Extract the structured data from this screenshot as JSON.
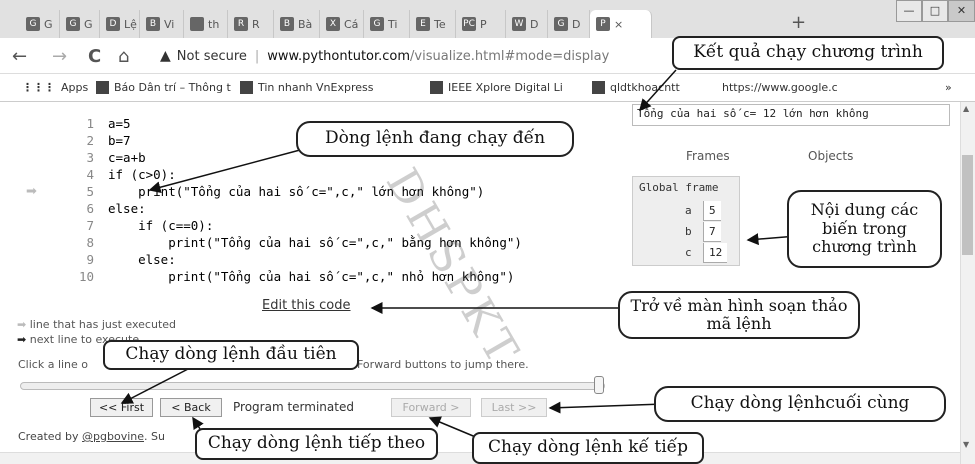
{
  "tabs": [
    {
      "label": "G",
      "fav": "G"
    },
    {
      "label": "G",
      "fav": "G"
    },
    {
      "label": "Lệ",
      "fav": "D"
    },
    {
      "label": "Vi",
      "fav": "B"
    },
    {
      "label": "th",
      "fav": ""
    },
    {
      "label": "R",
      "fav": "R"
    },
    {
      "label": "Bà",
      "fav": "B"
    },
    {
      "label": "Cá",
      "fav": "X"
    },
    {
      "label": "Ti",
      "fav": "G"
    },
    {
      "label": "Te",
      "fav": "E"
    },
    {
      "label": "P",
      "fav": "PC"
    },
    {
      "label": "D",
      "fav": "W"
    },
    {
      "label": "D",
      "fav": "G"
    },
    {
      "label": "×",
      "fav": "P"
    }
  ],
  "window_buttons": {
    "minimize": "—",
    "maximize": "□",
    "close": "✕"
  },
  "toolbar": {
    "back": "←",
    "forward": "→",
    "reload": "C",
    "home": "⌂",
    "security": "Not secure",
    "url_host": "www.pythontutor.com",
    "url_path": "/visualize.html#mode=display"
  },
  "bookmarks": [
    {
      "label": "Apps"
    },
    {
      "label": "Báo Dân trí – Thông t"
    },
    {
      "label": "Tin nhanh VnExpress"
    },
    {
      "label": "IEEE Xplore Digital Li"
    },
    {
      "label": "qldtkhoacntt"
    },
    {
      "label": "https://www.google.c"
    },
    {
      "label": "»"
    }
  ],
  "code": [
    {
      "n": "1",
      "text": "a=5"
    },
    {
      "n": "2",
      "text": "b=7"
    },
    {
      "n": "3",
      "text": "c=a+b"
    },
    {
      "n": "4",
      "text": "if (c>0):"
    },
    {
      "n": "5",
      "text": "    print(\"Tổng của hai số c=\",c,\" lớn hơn không\")"
    },
    {
      "n": "6",
      "text": "else:"
    },
    {
      "n": "7",
      "text": "    if (c==0):"
    },
    {
      "n": "8",
      "text": "        print(\"Tổng của hai số c=\",c,\" bằng hơn không\")"
    },
    {
      "n": "9",
      "text": "    else:"
    },
    {
      "n": "10",
      "text": "        print(\"Tổng của hai số c=\",c,\" nhỏ hơn không\")"
    }
  ],
  "current_line_arrow": "➡",
  "edit_link": "Edit this code",
  "legend": {
    "executed": "line that has just executed",
    "next": "next line to execute",
    "hint_start": "Click a line o",
    "hint_end": "Forward buttons to jump there."
  },
  "controls": {
    "first": "<< First",
    "back": "< Back",
    "status": "Program terminated",
    "forward": "Forward >",
    "last": "Last >>"
  },
  "footer": {
    "prefix": "Created by ",
    "author": "@pgbovine",
    "suffix": ". Su"
  },
  "output_text": "Tổng của hai số c= 12  lớn hơn không",
  "frames_label": "Frames",
  "objects_label": "Objects",
  "global_frame": "Global frame",
  "variables": [
    {
      "name": "a",
      "value": "5"
    },
    {
      "name": "b",
      "value": "7"
    },
    {
      "name": "c",
      "value": "12"
    }
  ],
  "callouts": {
    "ket_qua": "Kết quả chạy chương trình",
    "dong_lenh": "Dòng lệnh đang chạy đến",
    "noi_dung": "Nội dung các biến trong chương trình",
    "tro_ve": "Trở về màn hình soạn thảo mã lệnh",
    "dau_tien": "Chạy dòng lệnh đầu tiên",
    "cuoi_cung": "Chạy dòng lệnhcuối cùng",
    "tiep_theo": "Chạy dòng lệnh tiếp theo",
    "ke_tiep": "Chạy dòng lệnh kế tiếp"
  },
  "watermark": "DHSPKT"
}
